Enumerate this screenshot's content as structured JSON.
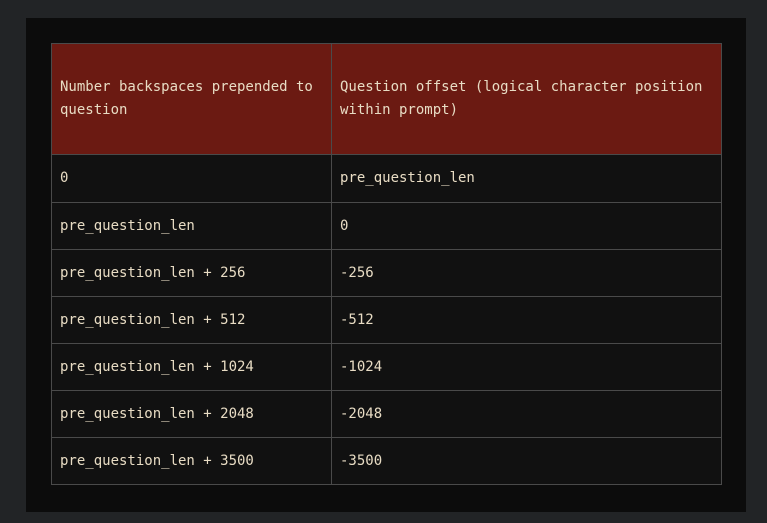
{
  "table": {
    "headers": [
      "Number backspaces prepended to question",
      "Question offset (logical character position within prompt)"
    ],
    "rows": [
      [
        "0",
        "pre_question_len"
      ],
      [
        "pre_question_len",
        "0"
      ],
      [
        "pre_question_len + 256",
        "-256"
      ],
      [
        "pre_question_len + 512",
        "-512"
      ],
      [
        "pre_question_len + 1024",
        "-1024"
      ],
      [
        "pre_question_len + 2048",
        "-2048"
      ],
      [
        "pre_question_len + 3500",
        "-3500"
      ]
    ]
  }
}
